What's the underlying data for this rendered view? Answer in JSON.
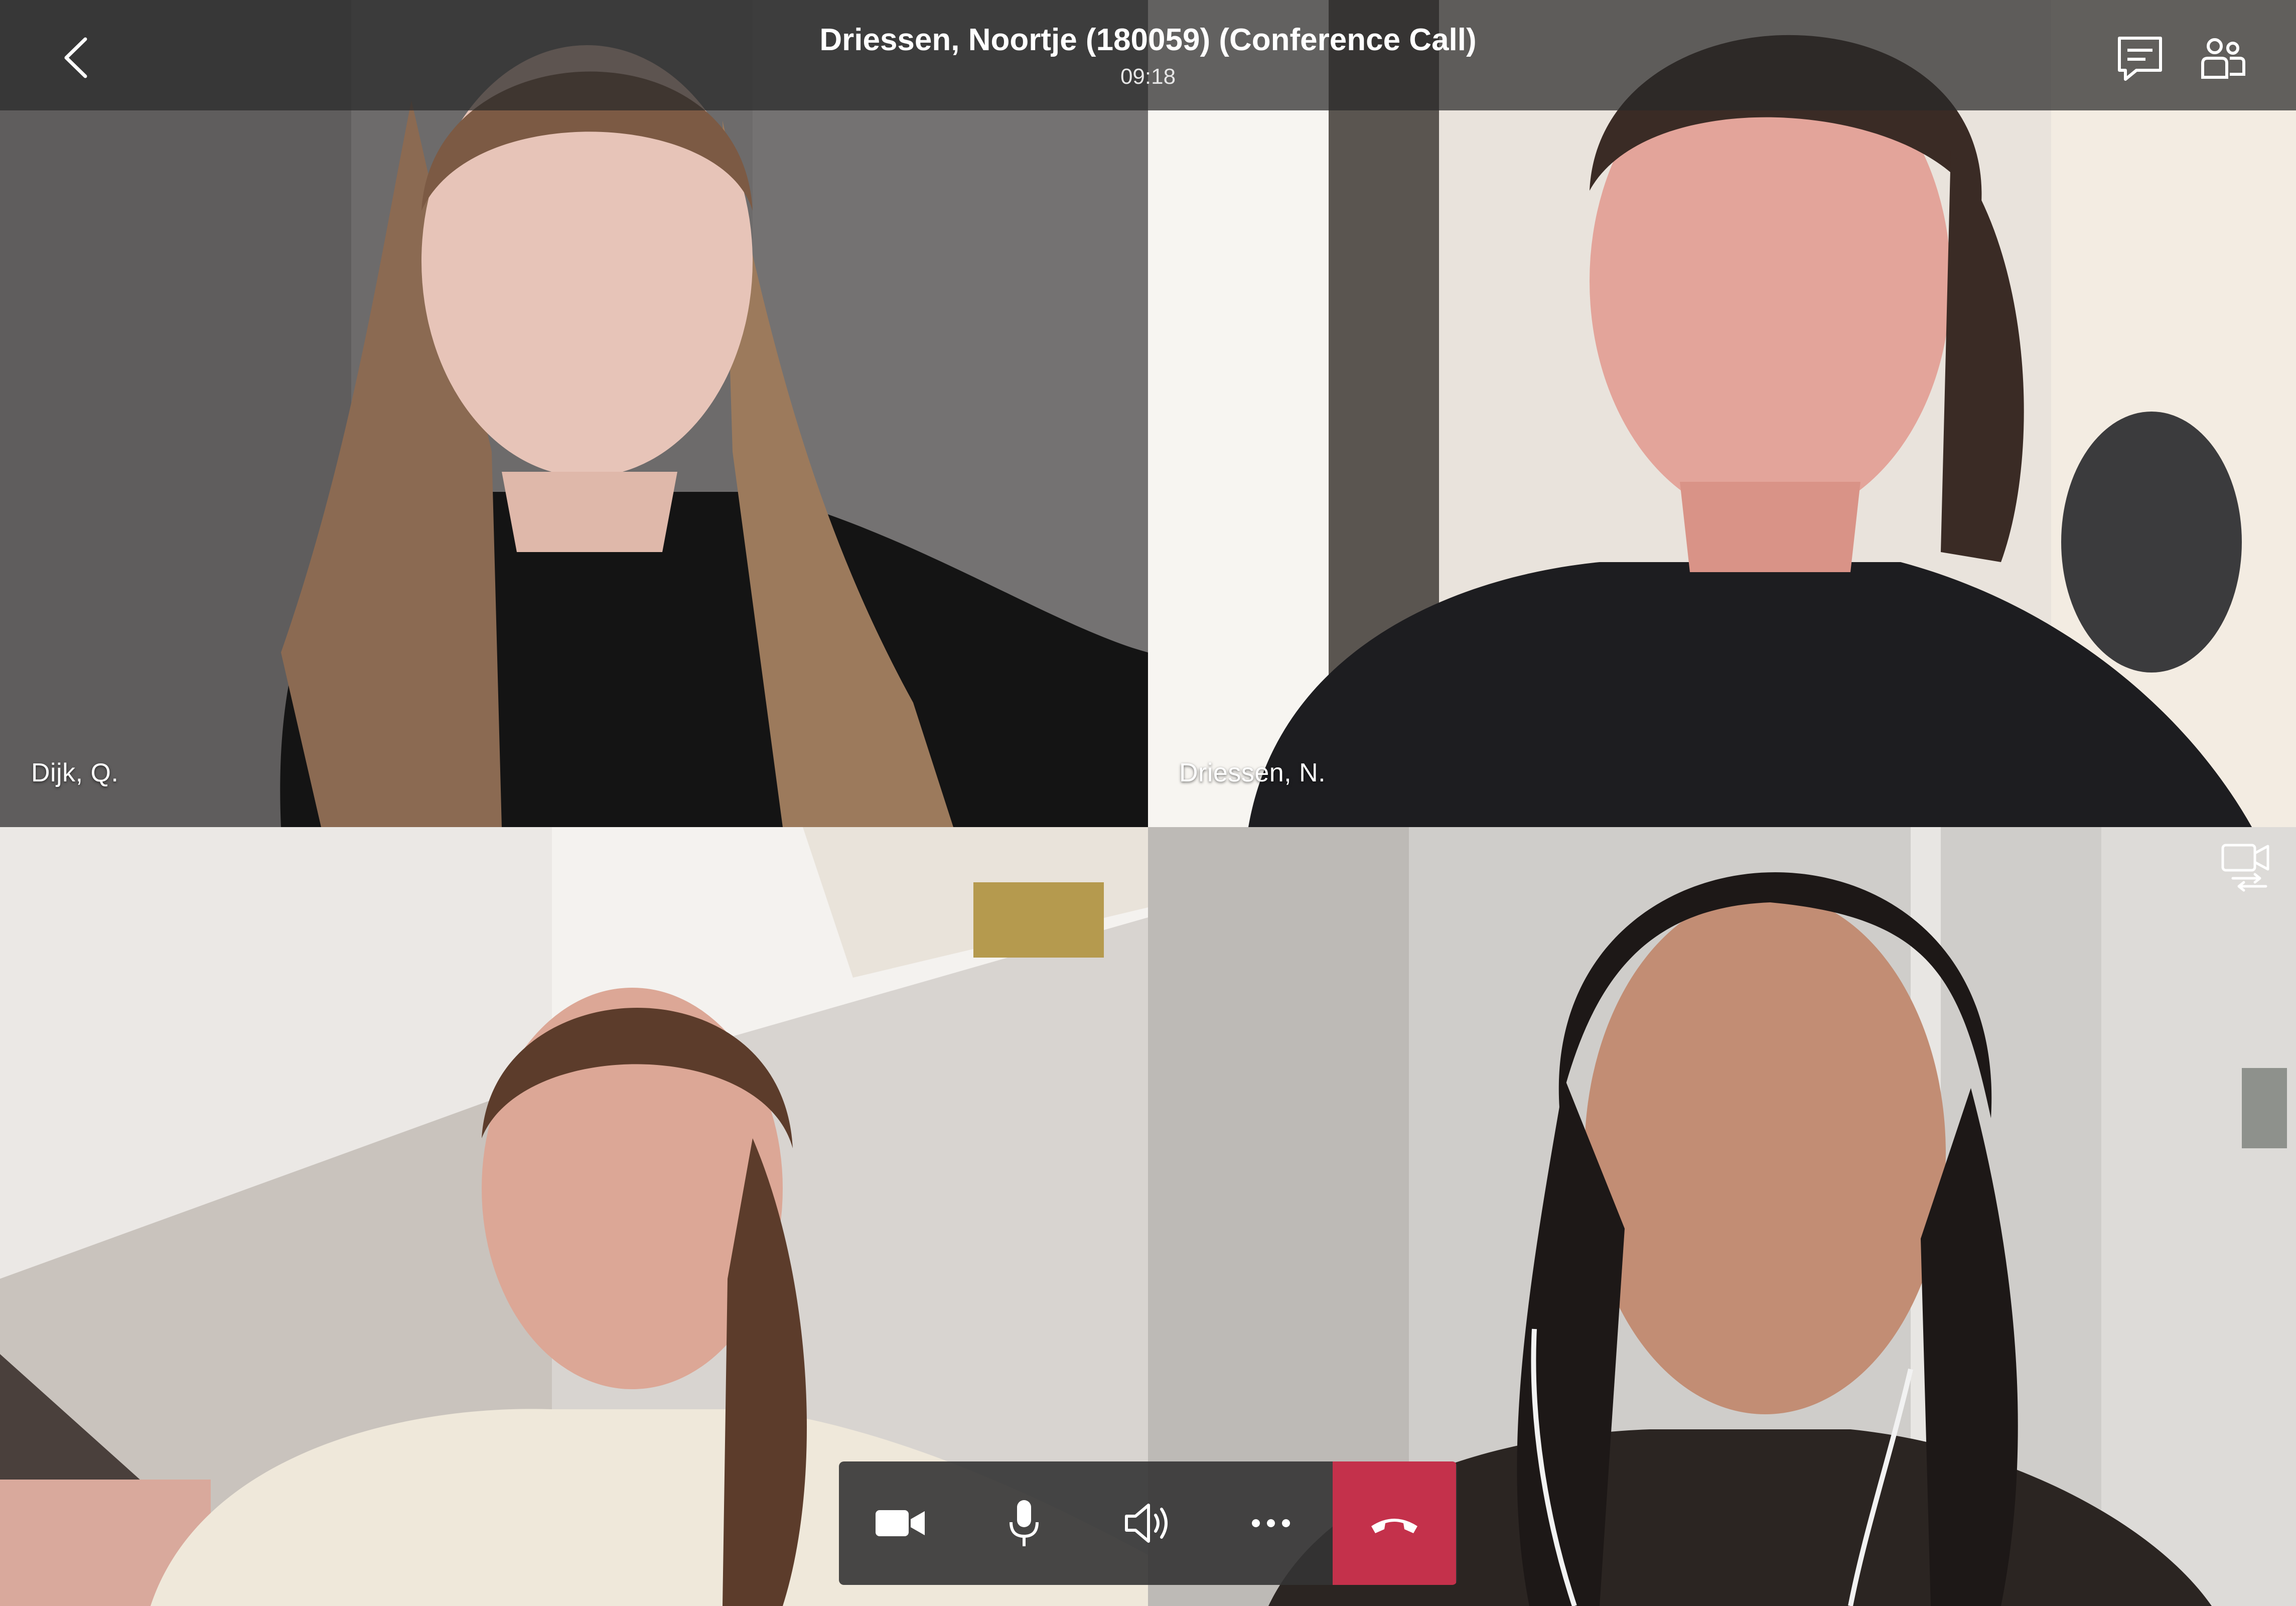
{
  "call": {
    "title": "Driessen, Noortje (180059) (Conference Call)",
    "duration": "09:18"
  },
  "participants": [
    {
      "name": "Dijk, Q."
    },
    {
      "name": "Driessen, N."
    },
    {
      "name": ""
    },
    {
      "name": ""
    }
  ],
  "icons": {
    "back": "chevron-left-icon",
    "chat": "chat-icon",
    "people": "people-icon",
    "switch_camera": "switch-camera-icon",
    "video": "video-camera-icon",
    "mic": "microphone-icon",
    "speaker": "speaker-icon",
    "more": "more-icon",
    "hangup": "hang-up-icon"
  },
  "colors": {
    "hangup": "#c4314b",
    "bar": "#343434",
    "icon": "#ffffff"
  }
}
